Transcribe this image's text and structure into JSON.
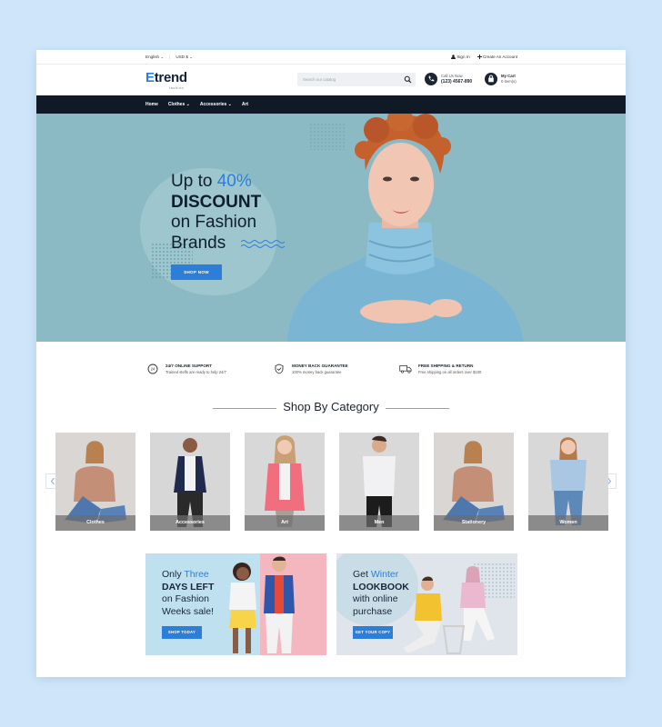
{
  "topbar": {
    "language": "English ⌄",
    "currency": "USD $ ⌄",
    "sign_in": "Sign In",
    "create_account": "Create An Account"
  },
  "header": {
    "logo_text": "trend",
    "logo_initial": "E",
    "logo_sub": "fashion",
    "search_placeholder": "Search our catalog",
    "call_label": "Call Us Now",
    "call_number": "(123) 4567-890",
    "cart_label": "My Cart",
    "cart_count": "0 item(s)"
  },
  "nav": {
    "items": [
      "Home",
      "Clothes ⌄",
      "Accessories ⌄",
      "Art"
    ]
  },
  "hero": {
    "line1_prefix": "Up to",
    "line1_highlight": "40%",
    "line2": "DISCOUNT",
    "line3": "on Fashion",
    "line4": "Brands",
    "button": "SHOP NOW"
  },
  "features": [
    {
      "title": "24/7 ONLINE SUPPORT",
      "desc": "Trained stelfs are ready to help 24/7",
      "icon": "support-24-icon"
    },
    {
      "title": "MONEY BACK GUARANTEE",
      "desc": "100% money back guarantee",
      "icon": "shield-check-icon"
    },
    {
      "title": "FREE SHIPPING & RETURN",
      "desc": "Free shipping on all orders over $100",
      "icon": "truck-icon"
    }
  ],
  "category": {
    "title": "Shop By Category",
    "items": [
      "Clothes",
      "Accessories",
      "Art",
      "Men",
      "Stationery",
      "Women"
    ]
  },
  "promo1": {
    "only": "Only",
    "three": "Three",
    "days_left": "DAYS LEFT",
    "on_fashion": "on Fashion",
    "weeks_sale": "Weeks sale!",
    "button": "SHOP TODAY"
  },
  "promo2": {
    "get": "Get",
    "winter": "Winter",
    "lookbook": "LOOKBOOK",
    "with_online": "with online",
    "purchase": "purchase",
    "button": "GET YOUR COPY"
  },
  "colors": {
    "accent": "#2c7ed6",
    "nav_bg": "#0f1a26",
    "hero_bg": "#8bbac4",
    "page_bg": "#cfe5fa"
  }
}
